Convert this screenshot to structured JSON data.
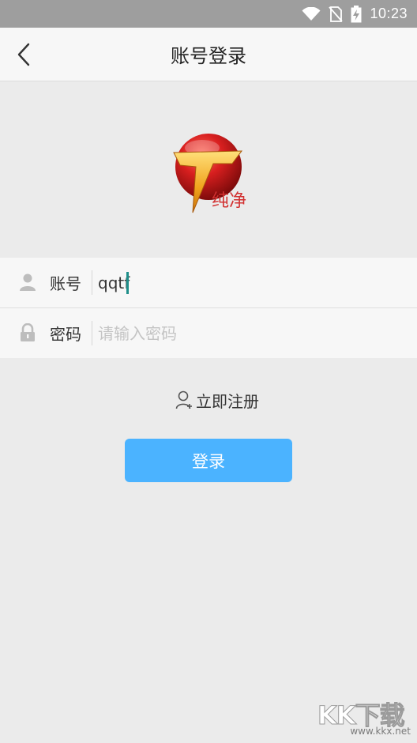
{
  "status_bar": {
    "time": "10:23",
    "icons": [
      "wifi-icon",
      "no-sim-icon",
      "battery-charging-icon"
    ]
  },
  "header": {
    "title": "账号登录",
    "back_icon": "chevron-left-icon"
  },
  "logo": {
    "caption": "纯净",
    "colors": {
      "ball": "#d81f1f",
      "letter": "#f0a21c",
      "caption": "#d23131"
    }
  },
  "form": {
    "account": {
      "icon": "user-icon",
      "label": "账号",
      "value": "qqtf"
    },
    "password": {
      "icon": "lock-icon",
      "label": "密码",
      "placeholder": "请输入密码"
    }
  },
  "register": {
    "icon": "add-user-icon",
    "label": "立即注册"
  },
  "login_button": {
    "label": "登录",
    "color": "#4bb3ff"
  },
  "watermark": {
    "main": "KK下载",
    "sub": "www.kkx.net"
  }
}
